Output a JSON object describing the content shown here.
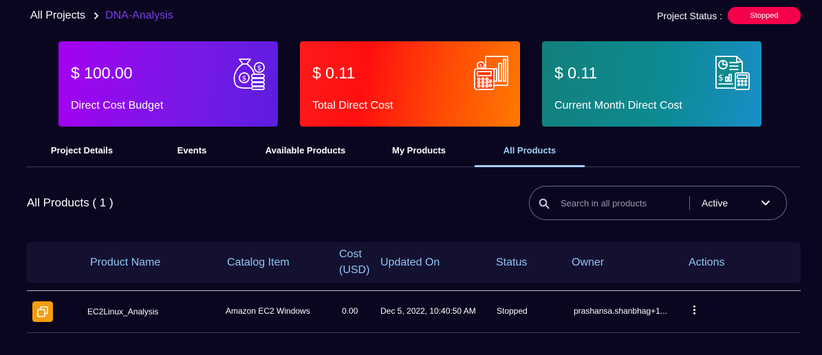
{
  "breadcrumb": {
    "root": "All Projects",
    "current": "DNA-Analysis"
  },
  "project_status": {
    "label": "Project Status :",
    "value": "Stopped",
    "color": "#f5004a"
  },
  "cards": [
    {
      "amount": "$ 100.00",
      "label": "Direct Cost Budget",
      "icon": "money-bag-coins-icon"
    },
    {
      "amount": "$ 0.11",
      "label": "Total Direct Cost",
      "icon": "calculator-chart-icon"
    },
    {
      "amount": "$ 0.11",
      "label": "Current Month Direct Cost",
      "icon": "report-calculator-icon"
    }
  ],
  "tabs": [
    {
      "label": "Project Details",
      "active": false
    },
    {
      "label": "Events",
      "active": false
    },
    {
      "label": "Available Products",
      "active": false
    },
    {
      "label": "My Products",
      "active": false
    },
    {
      "label": "All Products",
      "active": true
    }
  ],
  "section": {
    "title": "All Products ( 1 )"
  },
  "search": {
    "placeholder": "Search in all products",
    "value": "",
    "filter_value": "Active",
    "icon": "search-icon"
  },
  "table": {
    "columns": [
      "Product Name",
      "Catalog Item",
      "Cost (USD)",
      "Updated On",
      "Status",
      "Owner",
      "Actions"
    ],
    "column_lines": {
      "cost": [
        "Cost",
        "(USD)"
      ]
    },
    "rows": [
      {
        "icon": "ec2-instance-icon",
        "product_name": "EC2Linux_Analysis",
        "catalog_item": "Amazon EC2 Windows",
        "cost": "0.00",
        "updated_on": "Dec 5, 2022, 10:40:50 AM",
        "status": "Stopped",
        "owner": "prashansa.shanbhag+1...",
        "actions_icon": "more-vertical-icon"
      }
    ]
  },
  "colors": {
    "background": "#0a0620",
    "accent_link": "#7b3fe4",
    "table_header_text": "#8fc6f2",
    "tab_active": "#9fd0f5",
    "product_icon_bg": "#f59d0e"
  }
}
